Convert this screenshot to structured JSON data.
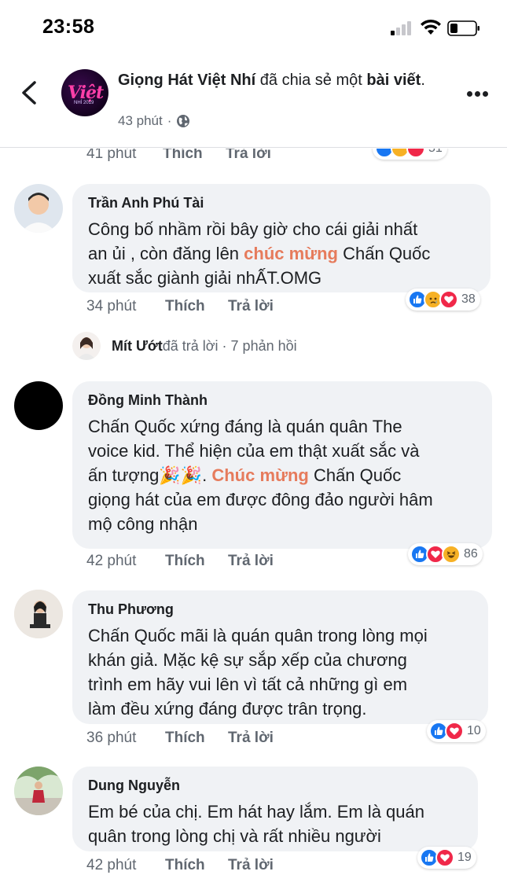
{
  "status": {
    "time": "23:58"
  },
  "header": {
    "page_name": "Giọng Hát Việt Nhí",
    "action_text": " đã chia sẻ một ",
    "object_text": "bài viết",
    "trail": ".",
    "time": "43 phút",
    "dot": "·",
    "logo_text": "Việt",
    "logo_sub": "NHÍ 2019"
  },
  "labels": {
    "like": "Thích",
    "reply": "Trả lời"
  },
  "top_partial": {
    "time": "41 phút",
    "reaction_count": "51"
  },
  "comments": [
    {
      "author": "Trần Anh Phú Tài",
      "parts": [
        {
          "text": "Công bố nhầm rồi bây giờ cho cái giải nhất\nan ủi , còn đăng lên ",
          "hl": false
        },
        {
          "text": "chúc mừng",
          "hl": true
        },
        {
          "text": " Chấn Quốc\nxuất sắc giành giải nhẤT.OMG",
          "hl": false
        }
      ],
      "time": "34 phút",
      "reactions": [
        "like",
        "sad",
        "love"
      ],
      "reaction_count": "38"
    },
    {
      "author": "Đồng Minh Thành",
      "parts": [
        {
          "text": "Chấn Quốc xứng đáng là quán quân The\nvoice kid. Thể hiện của em thật xuất sắc và\nấn tượng🎉🎉. ",
          "hl": false
        },
        {
          "text": "Chúc mừng",
          "hl": true
        },
        {
          "text": " Chấn Quốc\ngiọng hát của em được đông đảo người hâm\nmộ công nhận",
          "hl": false
        }
      ],
      "time": "42 phút",
      "reactions": [
        "like",
        "love",
        "haha"
      ],
      "reaction_count": "86"
    },
    {
      "author": "Thu Phương",
      "parts": [
        {
          "text": "Chấn Quốc mãi là quán quân trong lòng mọi\nkhán giả. Mặc kệ sự sắp xếp của chương\ntrình em hãy vui lên vì tất cả những gì em\nlàm đều xứng đáng được trân trọng.",
          "hl": false
        }
      ],
      "time": "36 phút",
      "reactions": [
        "like",
        "love"
      ],
      "reaction_count": "10"
    },
    {
      "author": "Dung Nguyễn",
      "parts": [
        {
          "text": "Em bé của chị. Em hát hay lắm. Em là quán\nquân trong lòng chị và rất nhiều người",
          "hl": false
        }
      ],
      "time": "42 phút",
      "reactions": [
        "like",
        "love"
      ],
      "reaction_count": "19"
    }
  ],
  "reply_summary": {
    "name": "Mít Ướt",
    "text": " đã trả lời · 7 phản hồi"
  },
  "colors": {
    "highlight": "#e67b5c",
    "like": "#1877f2",
    "love": "#f02849",
    "bubble": "#f0f2f5"
  }
}
